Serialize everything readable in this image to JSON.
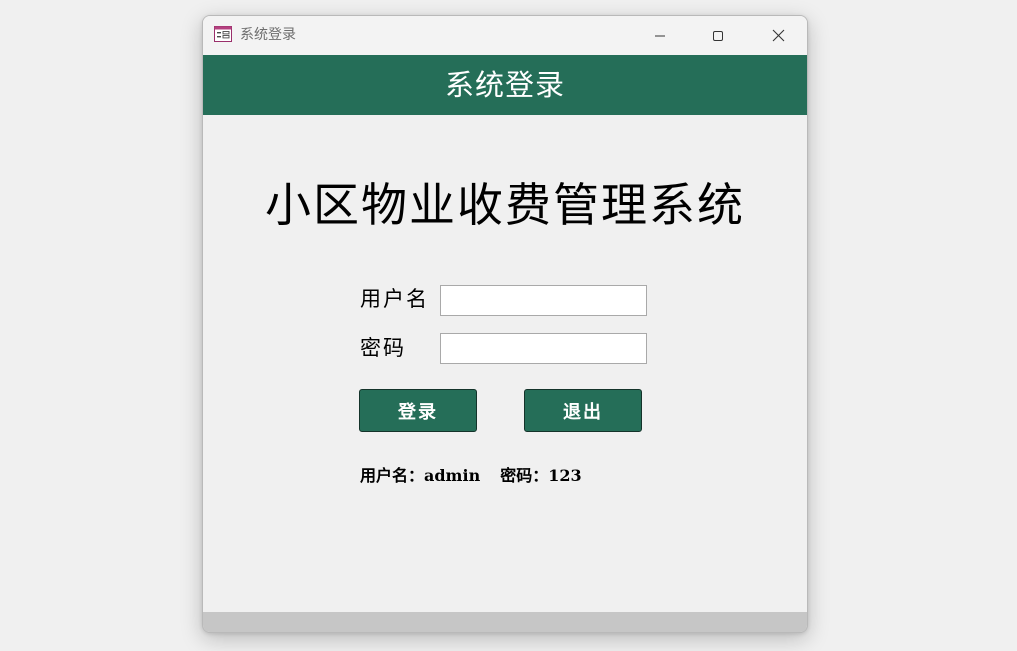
{
  "window": {
    "title": "系统登录",
    "app_icon": "form-window-icon",
    "controls": {
      "minimize_icon": "minimize-icon",
      "maximize_icon": "maximize-icon",
      "close_icon": "close-icon"
    }
  },
  "header": {
    "title": "系统登录"
  },
  "form": {
    "system_title": "小区物业收费管理系统",
    "username_label": "用户名",
    "username_value": "",
    "password_label": "密码",
    "password_value": "",
    "login_button": "登录",
    "exit_button": "退出",
    "hint": {
      "username_part": "用户名：admin",
      "password_part": "密码：123"
    }
  },
  "colors": {
    "accent": "#256e58",
    "button_border": "#14332a",
    "background": "#f0f0f0",
    "statusbar": "#c6c6c6"
  }
}
